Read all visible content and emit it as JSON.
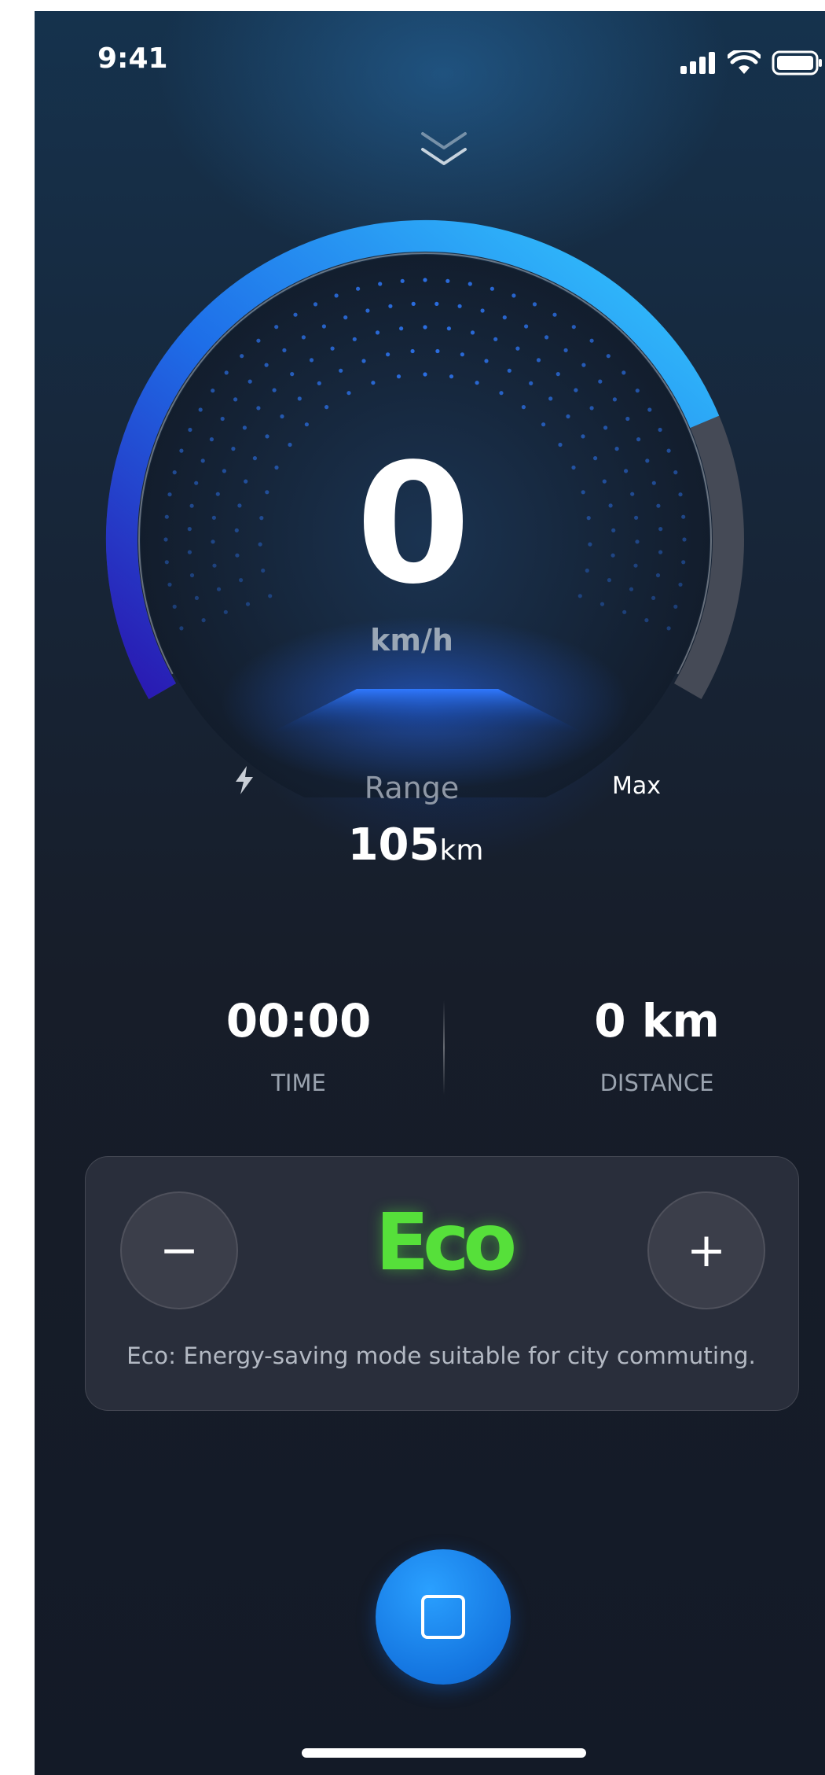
{
  "status_bar": {
    "time": "9:41"
  },
  "speedometer": {
    "speed": "0",
    "speed_unit": "km/h",
    "level_fraction": 0.78,
    "range_label": "Range",
    "range_value": "105",
    "range_unit": "km",
    "max_label": "Max"
  },
  "stats": {
    "time_value": "00:00",
    "time_label": "TIME",
    "distance_value": "0 km",
    "distance_label": "DISTANCE"
  },
  "mode": {
    "name": "Eco",
    "description": "Eco: Energy-saving mode suitable for city commuting.",
    "color": "#56e03a",
    "decrease_symbol": "−",
    "increase_symbol": "+"
  },
  "colors": {
    "accent_blue": "#2b8cf0",
    "gauge_start": "#2a17b0",
    "gauge_end": "#34c9ff"
  },
  "icons": [
    "collapse-chevron-icon",
    "bolt-icon",
    "signal-icon",
    "wifi-icon",
    "battery-icon",
    "stop-icon"
  ]
}
